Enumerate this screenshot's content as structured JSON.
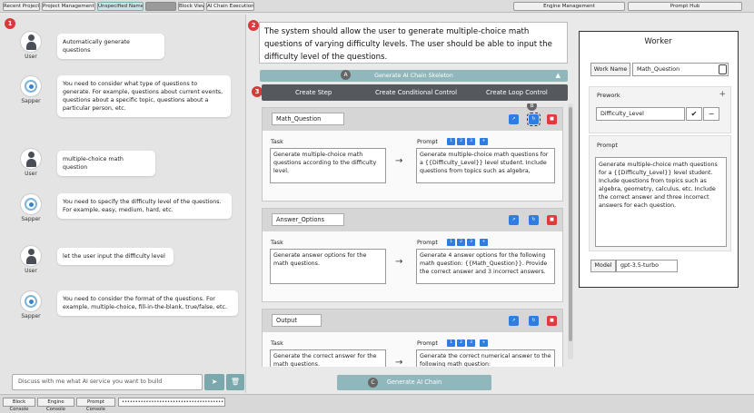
{
  "topbar": {
    "left_buttons": [
      "Recent Projects",
      "Project Management ▾",
      "Unspecified Name",
      "",
      "Block View",
      "AI Chain Execution ▾"
    ],
    "right_buttons": [
      "Engine Management",
      "Prompt Hub"
    ]
  },
  "markers": [
    "1",
    "2",
    "3",
    "4"
  ],
  "step_markers": [
    "A",
    "B",
    "C"
  ],
  "chat": {
    "messages": [
      {
        "role": "User",
        "text": "Automatically generate questions"
      },
      {
        "role": "Sapper",
        "text": "You need to consider what type of questions to generate. For example, questions about current events, questions about a specific topic, questions about a particular person, etc."
      },
      {
        "role": "User",
        "text": "multiple-choice math question"
      },
      {
        "role": "Sapper",
        "text": "You need to specify the difficulty level of the questions. For example, easy, medium, hard, etc."
      },
      {
        "role": "User",
        "text": "let the user input the difficulty level"
      },
      {
        "role": "Sapper",
        "text": "You need to consider the format of the questions. For example, multiple-choice, fill-in-the-blank, true/false, etc."
      }
    ],
    "input_placeholder": "Discuss with me what AI service you want to build",
    "send_icon": "➤",
    "delete_icon": "🗑"
  },
  "requirement": "The system should allow the user to generate multiple-choice math questions of varying difficulty levels. The user should be able to input the difficulty level of the questions.",
  "skeleton_label": "Generate AI Chain Skeleton",
  "controls": {
    "create_step": "Create Step",
    "create_conditional": "Create Conditional Control",
    "create_loop": "Create Loop Control"
  },
  "steps": [
    {
      "name": "Math_Question",
      "task_label": "Task",
      "prompt_label": "Prompt",
      "task": "Generate multiple-choice math questions according to the difficulty level.",
      "prompt": "Generate multiple-choice math questions for a {{Difficulty_Level}} level student. Include questions from topics such as algebra,"
    },
    {
      "name": "Answer_Options",
      "task_label": "Task",
      "prompt_label": "Prompt",
      "task": "Generate answer options for the math questions.",
      "prompt": "Generate 4 answer options for the following math question: {{Math_Question}}. Provide the correct answer and 3 incorrect answers."
    },
    {
      "name": "Output",
      "task_label": "Task",
      "prompt_label": "Prompt",
      "task": "Generate the correct answer for the math questions.",
      "prompt": "Generate the correct numerical answer to the following math question: {{Math_Question}}."
    }
  ],
  "pill_labels": [
    "1",
    "2",
    "3",
    "+"
  ],
  "arrow": "→",
  "generate_chain_label": "Generate AI Chain",
  "worker": {
    "title": "Worker",
    "name_label": "Work Name",
    "name_value": "Math_Question",
    "prework_label": "Prework",
    "prework_value": "Difficulty_Level",
    "prompt_label": "Prompt",
    "prompt_value": "Generate multiple-choice math questions for a {{Difficulty_Level}} level student. Include questions from topics such as algebra, geometry, calculus, etc. Include the correct answer and three incorrect answers for each question.",
    "model_label": "Model",
    "model_value": "gpt-3.5-turbo"
  },
  "bottombar": {
    "buttons": [
      "Block Console",
      "Engine Console",
      "Prompt Console"
    ],
    "field": "•••••••••••••••••••••••••••••••••••••••••••••"
  },
  "colors": {
    "accent": "#8fb7bc",
    "dark_bar": "#55595e",
    "marker_red": "#d63a3a",
    "button_blue": "#2f7de1",
    "button_red": "#e13a3a"
  }
}
